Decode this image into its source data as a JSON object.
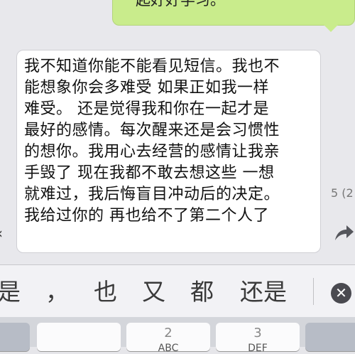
{
  "chat": {
    "sent_message": "一起好好学习。",
    "received_lines": [
      "我不知道你能不能看见短信。我也不",
      "能想象你会多难受 如果正如我一样",
      "难受。 还是觉得我和你在一起才是",
      "最好的感情。每次醒来还是会习惯性",
      "的想你。我用心去经营的感情让我亲",
      "手毁了 现在我都不敢去想这些 一想",
      "就难过，我后悔盲目冲动后的决定。",
      "我给过你的 再也给不了第二个人了"
    ],
    "timestamp": "5 (2",
    "left_caret": "‹"
  },
  "keyboard": {
    "candidates": [
      "是",
      "，",
      "也",
      "又",
      "都",
      "还是"
    ],
    "delete_symbol": "✕",
    "keys": [
      {
        "number": "",
        "letters": ""
      },
      {
        "number": "",
        "letters": ""
      },
      {
        "number": "2",
        "letters": "ABC"
      },
      {
        "number": "3",
        "letters": "DEF"
      },
      {
        "number": "",
        "letters": ""
      }
    ]
  },
  "icons": {
    "forward": "forward-arrow-icon",
    "delete": "delete-icon"
  },
  "colors": {
    "sent_bubble": "#c9ec8c",
    "received_bubble": "#ffffff",
    "background": "#e8e8ec"
  }
}
